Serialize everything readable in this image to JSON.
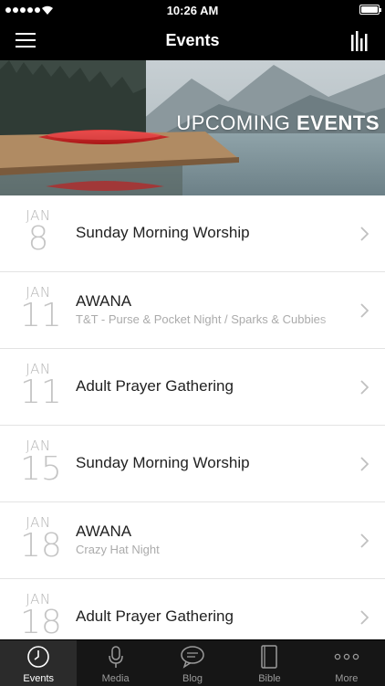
{
  "status_bar": {
    "time": "10:26 AM"
  },
  "nav": {
    "title": "Events"
  },
  "hero": {
    "text_light": "UPCOMING ",
    "text_bold": "EVENTS"
  },
  "events": [
    {
      "month": "JAN",
      "day": "8",
      "title": "Sunday Morning Worship",
      "subtitle": ""
    },
    {
      "month": "JAN",
      "day": "11",
      "title": "AWANA",
      "subtitle": "T&T - Purse & Pocket Night / Sparks & Cubbies"
    },
    {
      "month": "JAN",
      "day": "11",
      "title": "Adult Prayer Gathering",
      "subtitle": ""
    },
    {
      "month": "JAN",
      "day": "15",
      "title": "Sunday Morning Worship",
      "subtitle": ""
    },
    {
      "month": "JAN",
      "day": "18",
      "title": "AWANA",
      "subtitle": "Crazy Hat Night"
    },
    {
      "month": "JAN",
      "day": "18",
      "title": "Adult Prayer Gathering",
      "subtitle": ""
    }
  ],
  "tabs": [
    {
      "label": "Events",
      "icon": "clock-icon",
      "active": true
    },
    {
      "label": "Media",
      "icon": "microphone-icon",
      "active": false
    },
    {
      "label": "Blog",
      "icon": "chat-bubble-icon",
      "active": false
    },
    {
      "label": "Bible",
      "icon": "book-icon",
      "active": false
    },
    {
      "label": "More",
      "icon": "more-dots-icon",
      "active": false
    }
  ],
  "colors": {
    "bar_bg": "#000000",
    "tab_bar_bg": "#161616",
    "tab_active_bg": "#2b2b2b",
    "date_gray": "#b5b5b5"
  }
}
